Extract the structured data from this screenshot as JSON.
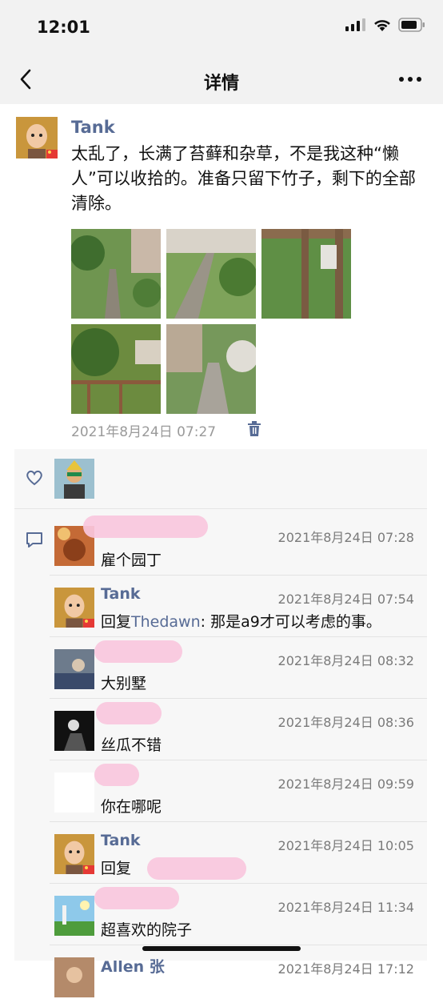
{
  "status_bar": {
    "time": "12:01"
  },
  "nav": {
    "title": "详情"
  },
  "post": {
    "author": "Tank",
    "text": "太乱了，长满了苔藓和杂草，不是我这种“懒人”可以收拾的。准备只留下竹子，剩下的全部清除。",
    "photos": [
      "garden-photo-1",
      "garden-photo-2",
      "garden-photo-3",
      "garden-photo-4",
      "garden-photo-5"
    ],
    "time": "2021年8月24日 07:27"
  },
  "comments": [
    {
      "name": "",
      "time": "2021年8月24日 07:28",
      "text": "雇个园丁"
    },
    {
      "name": "Tank",
      "time": "2021年8月24日 07:54",
      "reply_prefix": "回复",
      "reply_to": "Thedawn",
      "text": ": 那是a9才可以考虑的事。"
    },
    {
      "name": "",
      "time": "2021年8月24日 08:32",
      "text": "大别墅"
    },
    {
      "name": "",
      "time": "2021年8月24日 08:36",
      "text": "丝瓜不错"
    },
    {
      "name": "",
      "time": "2021年8月24日 09:59",
      "text": "你在哪呢"
    },
    {
      "name": "Tank",
      "time": "2021年8月24日 10:05",
      "text": "回复"
    },
    {
      "name": "",
      "time": "2021年8月24日 11:34",
      "text": "超喜欢的院子"
    },
    {
      "name": "Allen 张",
      "time": "2021年8月24日 17:12",
      "text": ""
    }
  ],
  "colors": {
    "link_blue": "#576b95",
    "redaction_pink": "#f9c7dd",
    "header_bg": "#f2f2f2",
    "panel_bg": "#f7f7f7"
  },
  "icons": [
    "back-icon",
    "more-icon",
    "trash-icon",
    "heart-icon",
    "comment-icon",
    "signal-icon",
    "wifi-icon",
    "battery-icon"
  ]
}
